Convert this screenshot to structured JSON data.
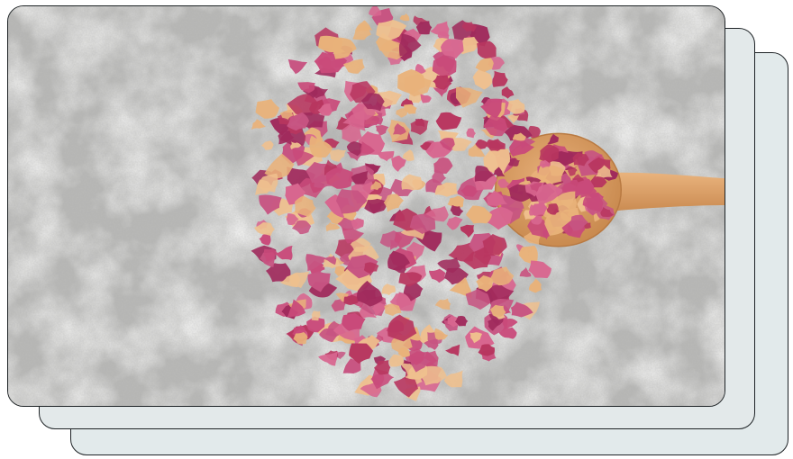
{
  "image": {
    "subject": "dried-rose-petals",
    "colors": {
      "concrete": "#bdbdbb",
      "petal_pink": "#c94a7a",
      "petal_magenta": "#a02a5c",
      "petal_peach": "#e9b27a",
      "spoon_wood": "#d9a066",
      "card_back": "#e2eaeb",
      "card_border": "#1e2326"
    }
  }
}
